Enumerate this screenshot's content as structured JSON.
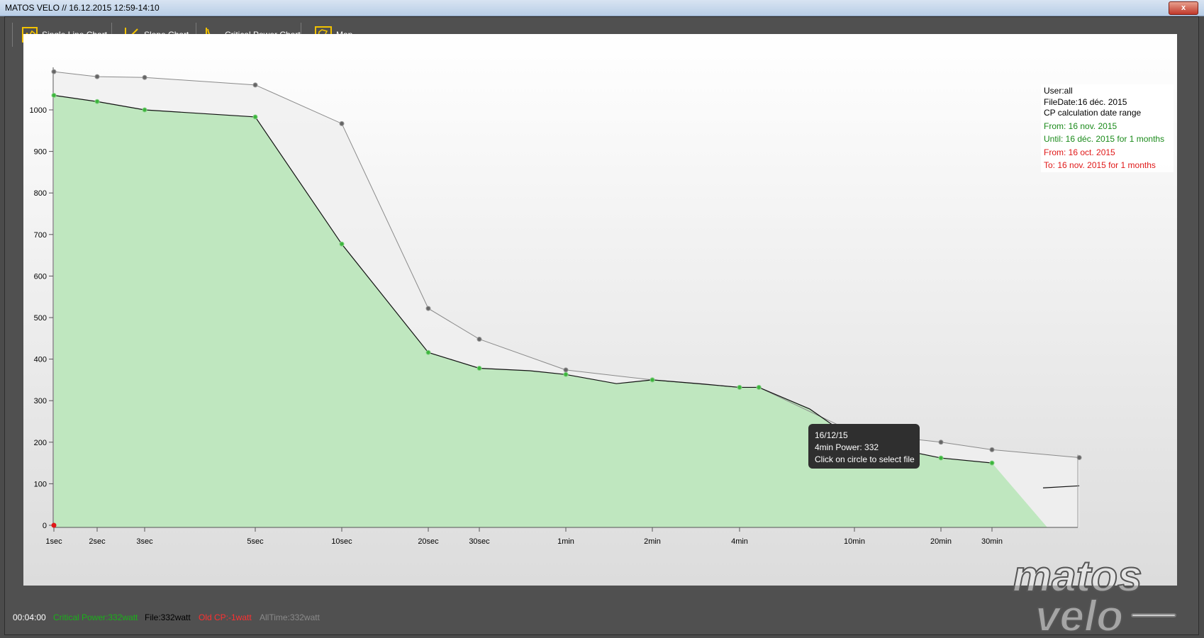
{
  "window": {
    "title": "MATOS VELO // 16.12.2015 12:59-14:10",
    "close_label": "x"
  },
  "toolbar": {
    "buttons": [
      {
        "label": "Single Line Chart",
        "icon": "line-chart-icon"
      },
      {
        "label": "Slope Chart",
        "icon": "slope-chart-icon"
      },
      {
        "label": "Critical Power Chart",
        "icon": "critical-power-icon"
      },
      {
        "label": "Map",
        "icon": "map-icon"
      }
    ]
  },
  "legend": {
    "user": "User:all",
    "file_date": "FileDate:16 déc. 2015",
    "range_title": "CP calculation date range",
    "from_current": "From: 16 nov. 2015",
    "until_current": "Until: 16 déc. 2015 for 1 months",
    "from_old": "From: 16 oct. 2015",
    "to_old": "To: 16 nov. 2015 for 1 months"
  },
  "tooltip": {
    "date": "16/12/15",
    "power": "4min Power: 332",
    "hint": "Click on circle to select file"
  },
  "status": {
    "time": "00:04:00",
    "critical_power": "Critical Power:332watt",
    "file": "File:332watt",
    "old_cp": "Old CP:-1watt",
    "alltime": "AllTime:332watt"
  },
  "watermark": {
    "line1": "matos",
    "line2": "velo"
  },
  "colors": {
    "green_fill": "#b9e6b9",
    "green_line": "#1a9a1a",
    "alltime_line": "#8a8a8a",
    "red": "#e01818",
    "accent_yellow": "#f2c200"
  },
  "chart_data": {
    "type": "area",
    "title": "",
    "xlabel": "",
    "ylabel": "",
    "ylim": [
      0,
      1100
    ],
    "y_ticks": [
      "0",
      "100",
      "200",
      "300",
      "400",
      "500",
      "600",
      "700",
      "800",
      "900",
      "1000"
    ],
    "x_ticks": [
      "1sec",
      "2sec",
      "3sec",
      "5sec",
      "10sec",
      "20sec",
      "30sec",
      "1min",
      "2min",
      "4min",
      "10min",
      "20min",
      "30min"
    ],
    "x_tick_seconds": [
      1,
      2,
      3,
      5,
      10,
      20,
      30,
      60,
      120,
      240,
      600,
      1200,
      1800
    ],
    "series": [
      {
        "name": "File",
        "x_seconds": [
          1,
          2,
          3,
          5,
          10,
          20,
          30,
          45,
          60,
          90,
          120,
          180,
          240,
          280,
          420,
          600,
          1200,
          1800,
          2700,
          3600
        ],
        "values": [
          1035,
          1020,
          1000,
          983,
          677,
          416,
          378,
          372,
          363,
          341,
          350,
          340,
          332,
          332,
          280,
          205,
          162,
          150,
          90,
          95
        ]
      },
      {
        "name": "AllTime",
        "x_seconds": [
          1,
          2,
          3,
          5,
          10,
          20,
          30,
          60,
          120,
          240,
          280,
          600,
          1200,
          1800,
          3600
        ],
        "values": [
          1092,
          1080,
          1078,
          1060,
          967,
          522,
          448,
          374,
          350,
          332,
          332,
          223,
          200,
          182,
          163
        ]
      }
    ],
    "markers": {
      "file_points": [
        1,
        2,
        3,
        5,
        10,
        20,
        30,
        60,
        120,
        240,
        280,
        600,
        1200,
        1800
      ],
      "old_cp_point": {
        "x_seconds": 1,
        "value": 0
      }
    }
  }
}
